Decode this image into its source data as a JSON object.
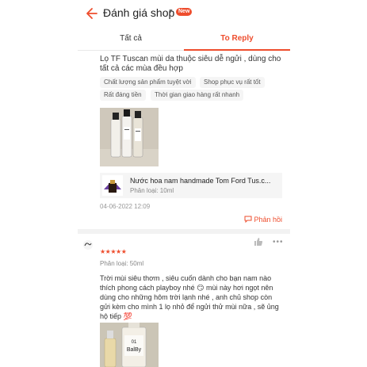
{
  "header": {
    "title": "Đánh giá shop",
    "badge": "New"
  },
  "tabs": [
    {
      "label": "Tất cả"
    },
    {
      "label": "To Reply"
    }
  ],
  "review1": {
    "text": "Lọ TF Tuscan mùi da thuộc siêu dễ ngửi , dùng cho tất cả các mùa đều hợp",
    "tags": [
      "Chất lượng sản phẩm tuyệt vời",
      "Shop phục vụ rất tốt",
      "Rất đáng tiền",
      "Thời gian giao hàng rất nhanh"
    ],
    "product": {
      "name": "Nước hoa nam handmade Tom Ford Tus.c...",
      "variant": "Phân loại: 10ml"
    },
    "date": "04-06-2022 12:09",
    "reply_label": "Phản hồi"
  },
  "review2": {
    "stars": "★★★★★",
    "variant": "Phân loại: 50ml",
    "text": "Trời mùi siêu thơm , siêu cuốn dành cho bạn nam nào thích phong cách playboy nhé 😏 mùi này hơi ngọt nên dùng cho những hôm trời lạnh nhé , anh chủ shop  còn gửi kèm cho mình 1 lọ nhỏ để ngửi thử mùi nữa , sẽ ủng hộ tiếp 💯",
    "photo_label_1": "01",
    "photo_label_2": "BalBy",
    "more_label": "•••"
  },
  "colors": {
    "accent": "#ee4d2d",
    "tag_bg": "#f5f5f5"
  }
}
